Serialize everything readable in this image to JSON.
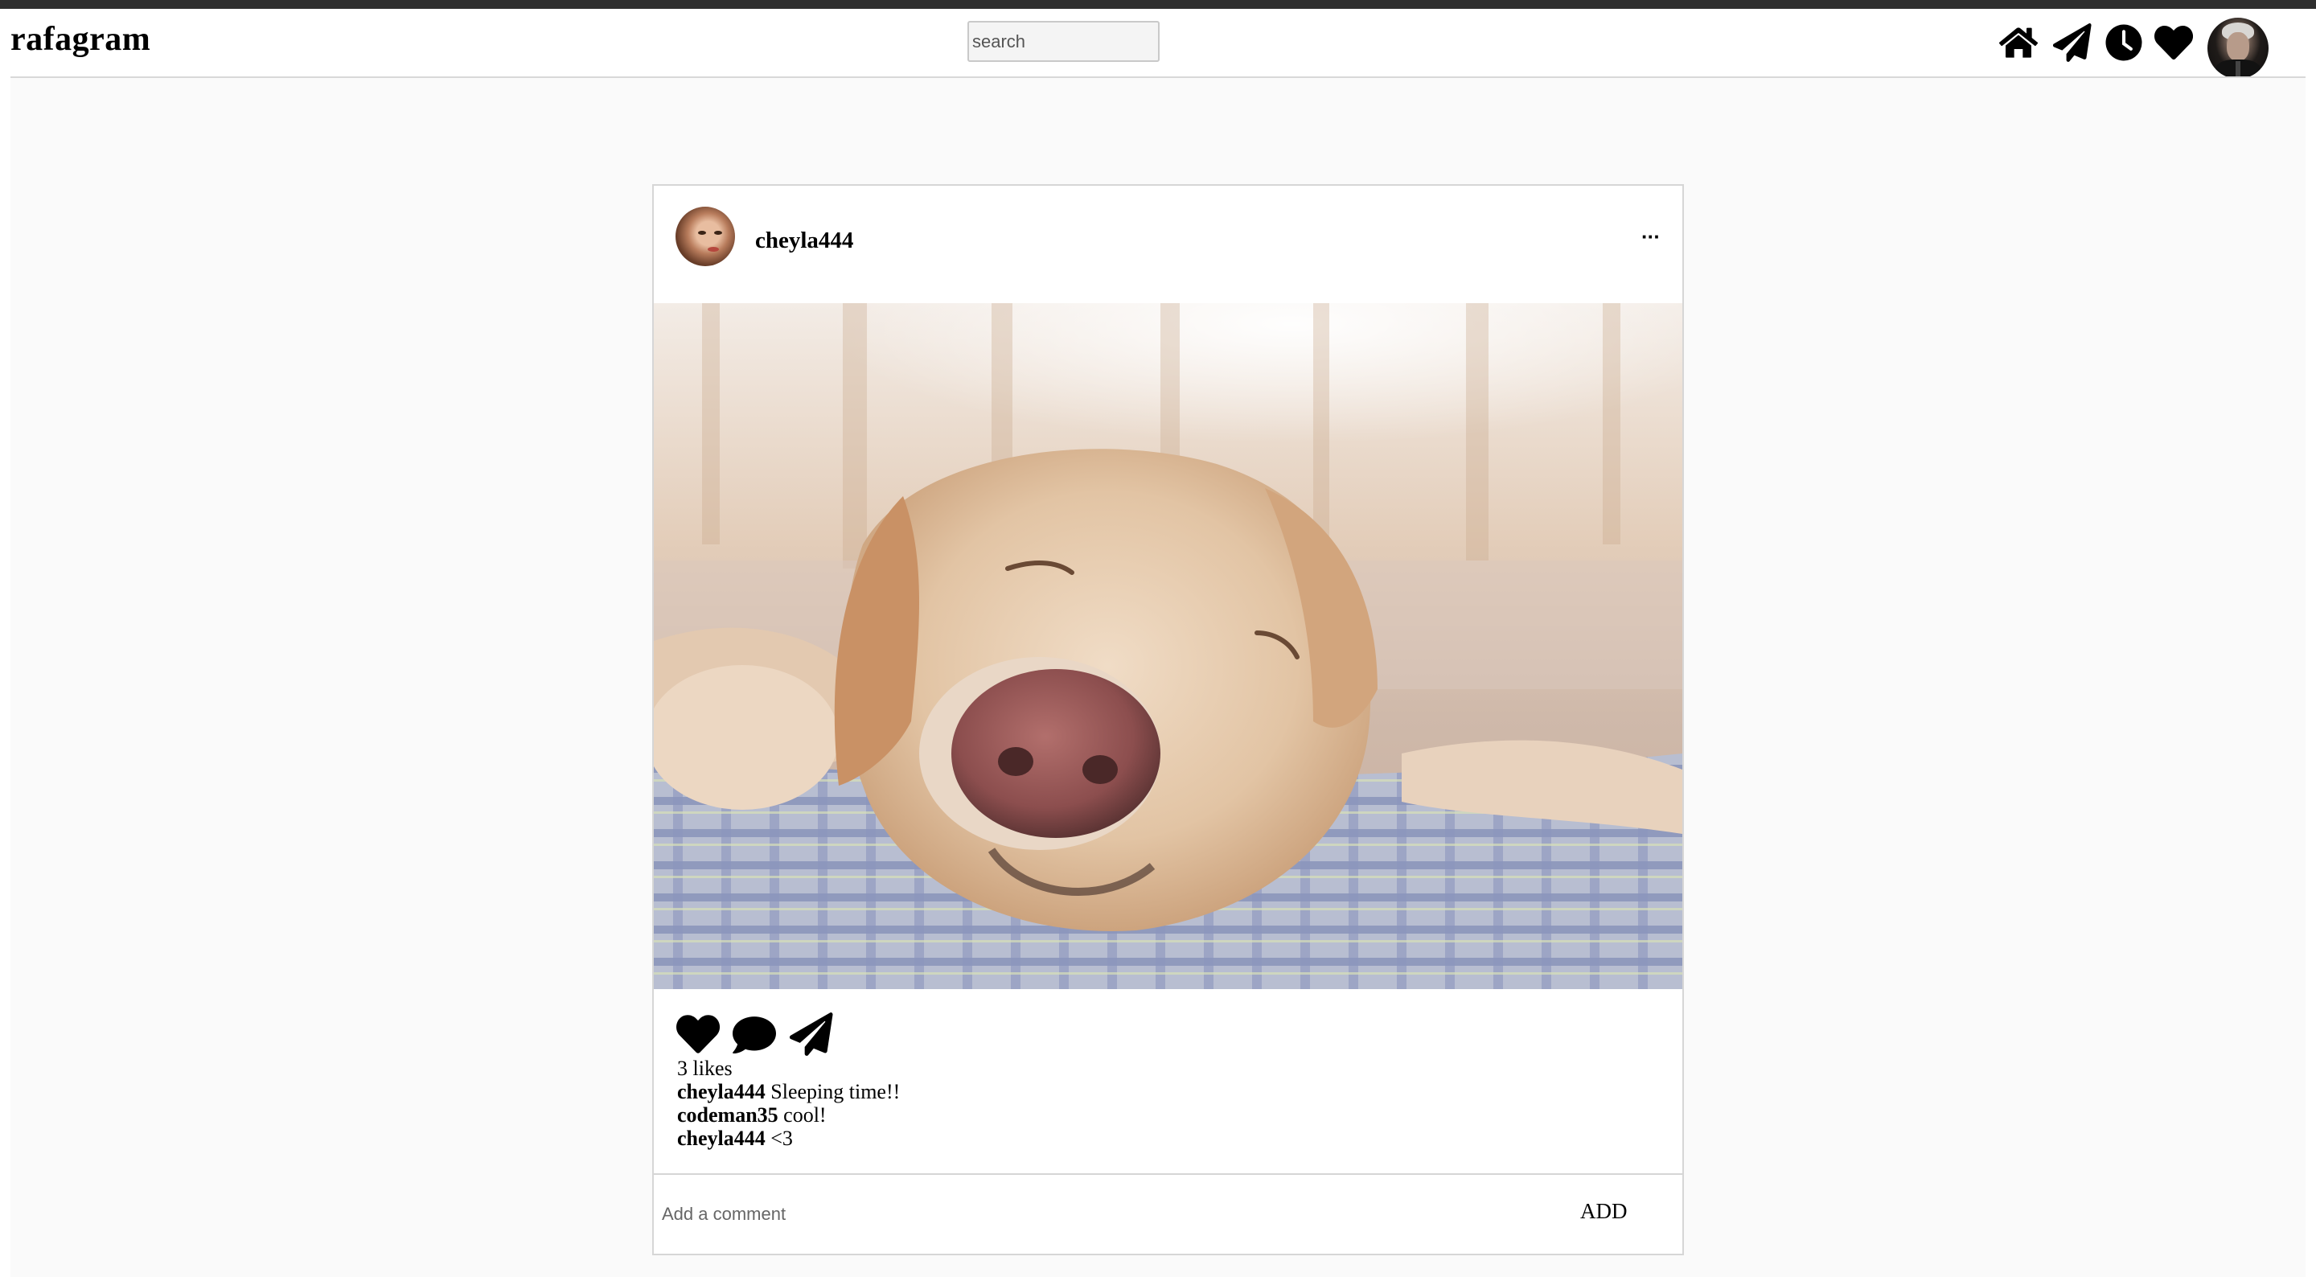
{
  "app": {
    "brand": "rafagram"
  },
  "header": {
    "search_placeholder": "search",
    "icons": [
      "home-icon",
      "paper-plane-icon",
      "clock-icon",
      "heart-icon"
    ]
  },
  "post": {
    "author": "cheyla444",
    "more_label": "···",
    "likes_text": "3 likes",
    "comments": [
      {
        "user": "cheyla444",
        "text": "Sleeping time!!"
      },
      {
        "user": "codeman35",
        "text": "cool!"
      },
      {
        "user": "cheyla444",
        "text": "<3"
      }
    ]
  },
  "comment_form": {
    "placeholder": "Add a comment",
    "add_label": "ADD"
  },
  "colors": {
    "topbar": "#2f2f2f",
    "background": "#fafafa",
    "border": "#d6d6d6"
  }
}
